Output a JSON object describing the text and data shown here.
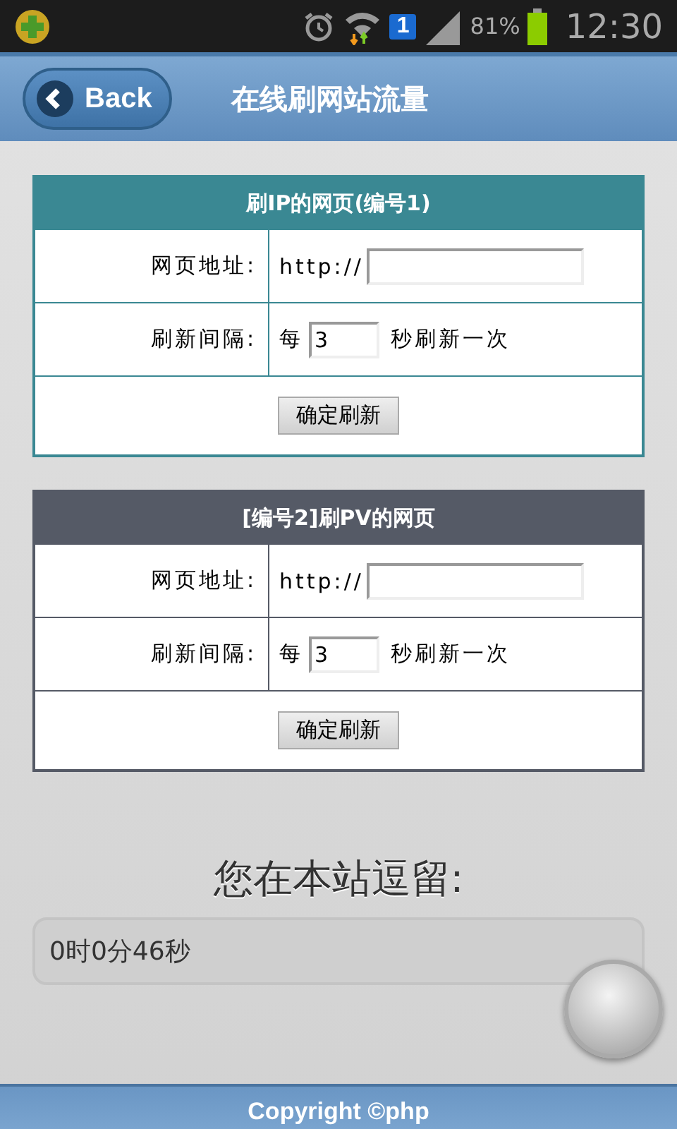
{
  "status_bar": {
    "sim_label": "1",
    "battery_text": "81%",
    "time": "12:30"
  },
  "header": {
    "back": "Back",
    "title": "在线刷网站流量"
  },
  "forms": [
    {
      "title": "刷IP的网页(编号1)",
      "color": "#3a8893",
      "url_label": "网页地址:",
      "url_prefix": "http://",
      "interval_label": "刷新间隔:",
      "interval_prefix": "每",
      "interval_value": "3",
      "interval_suffix": "秒刷新一次",
      "button": "确定刷新"
    },
    {
      "title": "[编号2]刷PV的网页",
      "color": "#555a66",
      "url_label": "网页地址:",
      "url_prefix": "http://",
      "interval_label": "刷新间隔:",
      "interval_prefix": "每",
      "interval_value": "3",
      "interval_suffix": "秒刷新一次",
      "button": "确定刷新"
    }
  ],
  "stay": {
    "title": "您在本站逗留:",
    "value": "0时0分46秒"
  },
  "footer": {
    "text": "Copyright ©php"
  }
}
